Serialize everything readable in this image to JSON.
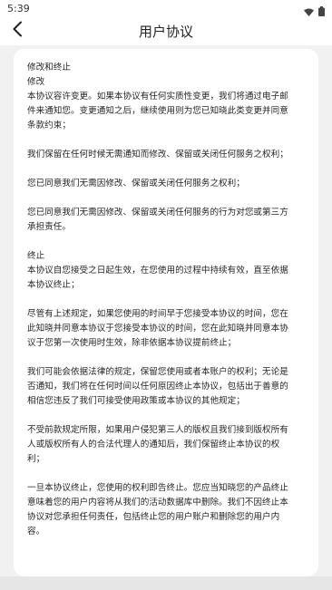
{
  "status_bar": {
    "time": "5:39",
    "icons": [
      "wifi-icon",
      "battery-icon"
    ]
  },
  "header": {
    "title": "用户协议",
    "back_icon": "back-arrow-icon"
  },
  "content": {
    "lines": [
      "修改和终止",
      "修改",
      "本协议容许变更。如果本协议有任何实质性变更，我们将通过电子邮",
      "件来通知您。变更通知之后，继续使用则为您已知晓此类变更并同意",
      "条款约束；",
      "",
      "我们保留在任何时候无需通知而修改、保留或关闭任何服务之权利；",
      "",
      "您已同意我们无需因修改、保留或关闭任何服务之权利；",
      "",
      "您已同意我们无需因修改、保留或关闭任何服务的行为对您或第三方",
      "承担责任。",
      "",
      "终止",
      "本协议自您接受之日起生效，在您使用的过程中持续有效，直至依据",
      "本协议终止；",
      "",
      "尽管有上述规定，如果您使用的时间早于您接受本协议的时间，您在",
      "此知晓并同意本协议于您接受本协议的时间，您在此知晓并同意本协",
      "议于您第一次使用时生效，除非依据本协议提前终止；",
      "",
      "我们可能会依据法律的规定，保留您使用或者本账户的权利；无论是",
      "否通知，我们将在任何时间以任何原因终止本协议，包括出于善意的",
      "相信您违反了我们可接受使用政策或本协议的其他规定；",
      "",
      "不受前款规定所限，如果用户侵犯第三人的版权且我们接到版权所有",
      "人或版权所有人的合法代理人的通知后，我们保留终止本协议的权",
      "利；",
      "",
      "一旦本协议终止，您使用的权利即告终止。您应当知晓您的产品终止",
      "意味着您的用户内容将从我们的活动数据库中删除。我们不因终止本",
      "协议对您承担任何责任，包括终止您的用户账户和删除您的用户内",
      "容。"
    ]
  }
}
